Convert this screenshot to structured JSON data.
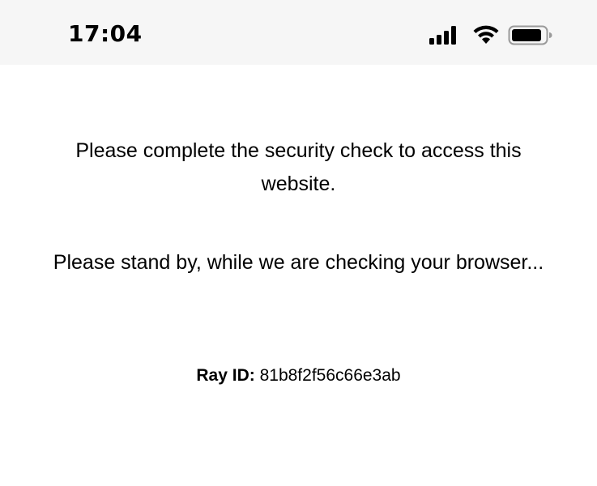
{
  "status_bar": {
    "time": "17:04",
    "icons": [
      "cellular-signal-icon",
      "wifi-icon",
      "battery-icon"
    ]
  },
  "page": {
    "message_1": "Please complete the security check to access this website.",
    "message_2": "Please stand by, while we are checking your browser...",
    "ray_label": "Ray ID:",
    "ray_value": "81b8f2f56c66e3ab"
  },
  "colors": {
    "status_bar_bg": "#f6f6f6",
    "page_bg": "#ffffff",
    "text": "#000000"
  }
}
